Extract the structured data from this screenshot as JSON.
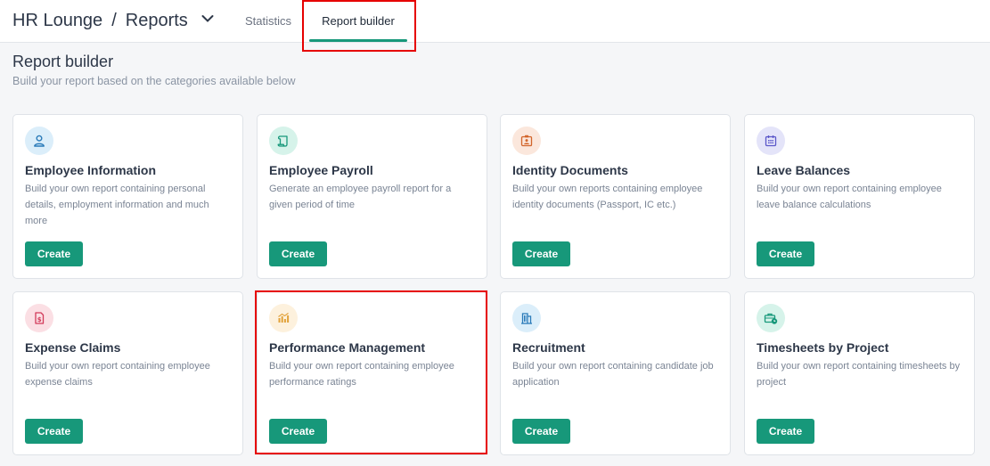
{
  "header": {
    "org": "HR Lounge",
    "separator": "/",
    "section": "Reports",
    "tabs": [
      {
        "label": "Statistics",
        "active": false
      },
      {
        "label": "Report builder",
        "active": true
      }
    ]
  },
  "page": {
    "title": "Report builder",
    "subtitle": "Build your report based on the categories available below"
  },
  "colors": {
    "accent": "#17987a",
    "highlight": "#e60000"
  },
  "cards": [
    {
      "title": "Employee Information",
      "description": "Build your own report containing personal details, employment information and much more",
      "button": "Create",
      "icon": "user-icon"
    },
    {
      "title": "Employee Payroll",
      "description": "Generate an employee payroll report for a given period of time",
      "button": "Create",
      "icon": "scroll-icon"
    },
    {
      "title": "Identity Documents",
      "description": "Build your own reports containing employee identity documents (Passport, IC etc.)",
      "button": "Create",
      "icon": "id-badge-icon"
    },
    {
      "title": "Leave Balances",
      "description": "Build your own report containing employee leave balance calculations",
      "button": "Create",
      "icon": "calendar-icon"
    },
    {
      "title": "Expense Claims",
      "description": "Build your own report containing employee expense claims",
      "button": "Create",
      "icon": "receipt-icon"
    },
    {
      "title": "Performance Management",
      "description": "Build your own report containing employee performance ratings",
      "button": "Create",
      "icon": "bar-chart-icon"
    },
    {
      "title": "Recruitment",
      "description": "Build your own report containing candidate job application",
      "button": "Create",
      "icon": "building-icon"
    },
    {
      "title": "Timesheets by Project",
      "description": "Build your own report containing timesheets by project",
      "button": "Create",
      "icon": "briefcase-clock-icon"
    }
  ]
}
